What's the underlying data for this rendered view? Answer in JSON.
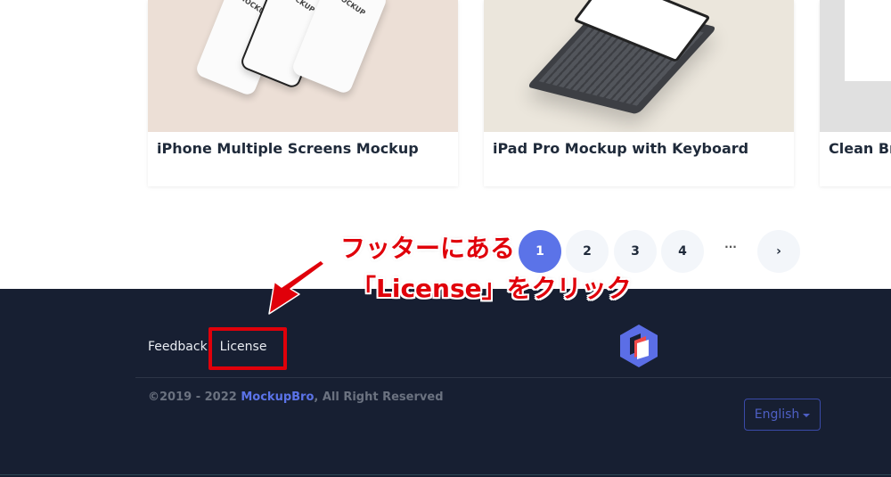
{
  "cards": [
    {
      "title": "iPhone Multiple Screens Mockup",
      "mockup_label": "MOCKUP"
    },
    {
      "title": "iPad Pro Mockup with Keyboard"
    },
    {
      "title": "Clean Br"
    }
  ],
  "pagination": {
    "pages": [
      "1",
      "2",
      "3",
      "4"
    ],
    "active_page": "1",
    "ellipsis": "···",
    "next": "›"
  },
  "footer": {
    "links": [
      "Feedback",
      "License"
    ],
    "copyright_prefix": "©2019 - 2022 ",
    "brand": "MockupBro",
    "copyright_suffix": ", All Right Reserved",
    "language": "English",
    "logo_icon": "mockupbro-hexagon-logo"
  },
  "annotation": {
    "line1": "フッターにある",
    "line2": "「License」をクリック",
    "color": "#e0000a"
  },
  "colors": {
    "accent": "#5b73e8",
    "footer_bg": "#171f32"
  }
}
